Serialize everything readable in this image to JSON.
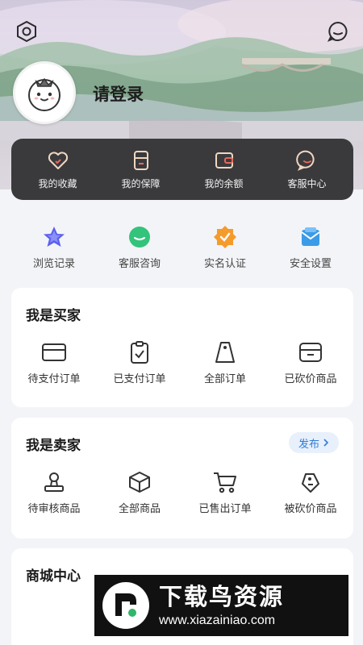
{
  "header": {
    "login_prompt": "请登录"
  },
  "quick_card": {
    "items": [
      {
        "label": "我的收藏",
        "icon": "heart-icon"
      },
      {
        "label": "我的保障",
        "icon": "document-icon"
      },
      {
        "label": "我的余额",
        "icon": "wallet-icon"
      },
      {
        "label": "客服中心",
        "icon": "chat-icon"
      }
    ]
  },
  "shortcuts": {
    "items": [
      {
        "label": "浏览记录",
        "icon": "star-icon",
        "color": "#5b5ff0"
      },
      {
        "label": "客服咨询",
        "icon": "chat-bubble-icon",
        "color": "#33c37b"
      },
      {
        "label": "实名认证",
        "icon": "verified-badge-icon",
        "color": "#f59b2c"
      },
      {
        "label": "安全设置",
        "icon": "shield-mail-icon",
        "color": "#3b9be8"
      }
    ]
  },
  "buyer": {
    "title": "我是买家",
    "items": [
      {
        "label": "待支付订单",
        "icon": "card-icon"
      },
      {
        "label": "已支付订单",
        "icon": "clipboard-check-icon"
      },
      {
        "label": "全部订单",
        "icon": "tag-icon"
      },
      {
        "label": "已砍价商品",
        "icon": "box-card-icon"
      }
    ]
  },
  "seller": {
    "title": "我是卖家",
    "publish_label": "发布",
    "items": [
      {
        "label": "待审核商品",
        "icon": "stamp-icon"
      },
      {
        "label": "全部商品",
        "icon": "cube-icon"
      },
      {
        "label": "已售出订单",
        "icon": "cart-icon"
      },
      {
        "label": "被砍价商品",
        "icon": "price-tag-icon"
      }
    ]
  },
  "mall": {
    "title": "商城中心"
  },
  "watermark": {
    "title": "下载鸟资源",
    "url": "www.xiazainiao.com"
  }
}
